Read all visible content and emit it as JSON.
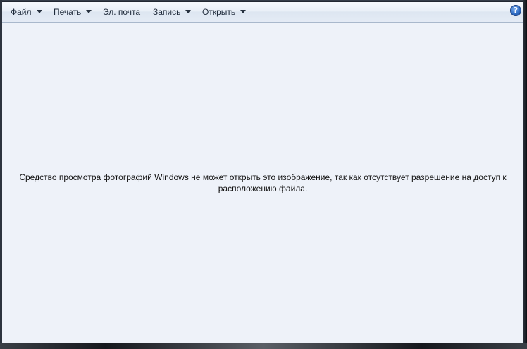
{
  "menu": {
    "items": [
      {
        "label": "Файл",
        "has_dropdown": true
      },
      {
        "label": "Печать",
        "has_dropdown": true
      },
      {
        "label": "Эл. почта",
        "has_dropdown": false
      },
      {
        "label": "Запись",
        "has_dropdown": true
      },
      {
        "label": "Открыть",
        "has_dropdown": true
      }
    ],
    "help_icon": "question-mark-icon",
    "help_glyph": "?"
  },
  "content": {
    "message_line1": "Средство просмотра фотографий Windows не может открыть это изображение, так как отсутствует разрешение на доступ к",
    "message_line2": "расположению файла."
  },
  "colors": {
    "content_background": "#eef2f9",
    "help_icon": "#2f6cc4",
    "frame": "#0c0f14"
  }
}
